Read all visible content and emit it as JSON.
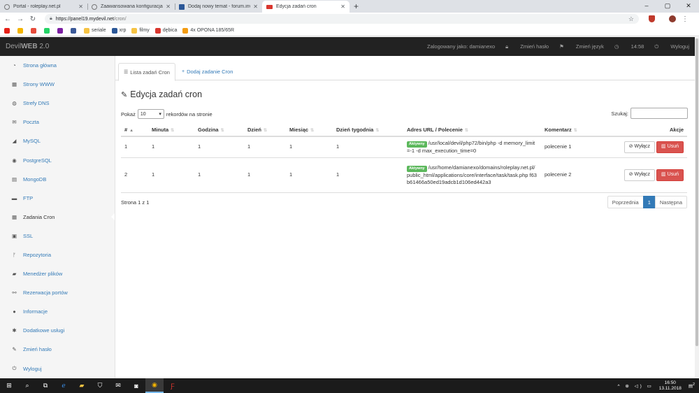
{
  "browser": {
    "tabs": [
      {
        "title": "Portal - roleplay.net.pl",
        "active": false
      },
      {
        "title": "Zaawansowana konfiguracja",
        "active": false
      },
      {
        "title": "Dodaj nowy temat - forum.invisi",
        "active": false
      },
      {
        "title": "Edycja zadań cron",
        "active": true
      }
    ],
    "new_tab": "+",
    "window_controls": [
      "–",
      "▢",
      "✕"
    ],
    "url_host": "https://panel19.mydevil.net",
    "url_path": "/cron/",
    "bookmarks": [
      {
        "label": "",
        "color": "#e62117"
      },
      {
        "label": "",
        "color": "#f4b400"
      },
      {
        "label": "",
        "color": "#e74c3c"
      },
      {
        "label": "",
        "color": "#25d366"
      },
      {
        "label": "",
        "color": "#7b1fa2"
      },
      {
        "label": "",
        "color": "#3b5998"
      },
      {
        "label": "seriale",
        "color": "#f6c343"
      },
      {
        "label": "xrp",
        "color": "#2b5797"
      },
      {
        "label": "filmy",
        "color": "#f6c343"
      },
      {
        "label": "dębica",
        "color": "#d9362e"
      },
      {
        "label": "4x OPONA 185/65R",
        "color": "#f39c12"
      }
    ]
  },
  "header": {
    "brand_main": "Devil",
    "brand_bold": "WEB",
    "brand_version": " 2.0",
    "logged_in": "Zalogowany jako: damianexo",
    "change_password": "Zmień hasło",
    "change_language": "Zmień język",
    "time": "14:58",
    "logout": "Wyloguj"
  },
  "sidebar": {
    "items": [
      {
        "label": "Strona główna",
        "icon": "dashboard-icon",
        "glyph": "◔"
      },
      {
        "label": "Strony WWW",
        "icon": "grid-icon",
        "glyph": "▦"
      },
      {
        "label": "Strefy DNS",
        "icon": "globe-icon",
        "glyph": "◍"
      },
      {
        "label": "Poczta",
        "icon": "envelope-icon",
        "glyph": "✉"
      },
      {
        "label": "MySQL",
        "icon": "dolphin-icon",
        "glyph": "◢"
      },
      {
        "label": "PostgreSQL",
        "icon": "elephant-icon",
        "glyph": "◉"
      },
      {
        "label": "MongoDB",
        "icon": "database-icon",
        "glyph": "▤"
      },
      {
        "label": "FTP",
        "icon": "folder-icon",
        "glyph": "▬"
      },
      {
        "label": "Zadania Cron",
        "icon": "calendar-icon",
        "glyph": "▦"
      },
      {
        "label": "SSL",
        "icon": "lock-icon",
        "glyph": "▣"
      },
      {
        "label": "Repozytoria",
        "icon": "branch-icon",
        "glyph": "ᚠ"
      },
      {
        "label": "Menedżer plików",
        "icon": "folder-open-icon",
        "glyph": "▰"
      },
      {
        "label": "Rezerwacja portów",
        "icon": "plug-icon",
        "glyph": "⚯"
      },
      {
        "label": "Informacje",
        "icon": "user-icon",
        "glyph": "●"
      },
      {
        "label": "Dodatkowe usługi",
        "icon": "asterisk-icon",
        "glyph": "✱"
      },
      {
        "label": "Zmień hasło",
        "icon": "pencil-icon",
        "glyph": "✎"
      },
      {
        "label": "Wyloguj",
        "icon": "power-icon",
        "glyph": "⏻"
      }
    ],
    "active_index": 8
  },
  "main": {
    "tabs": [
      {
        "label": "Lista zadań Cron",
        "glyph": "☰",
        "active": true
      },
      {
        "label": "Dodaj zadanie Cron",
        "glyph": "+",
        "active": false
      }
    ],
    "title": "Edycja zadań cron",
    "show_label": "Pokaż",
    "page_size": "10",
    "records_label": "rekordów na stronie",
    "search_label": "Szukaj:",
    "search_value": "",
    "columns": [
      "#",
      "Minuta",
      "Godzina",
      "Dzień",
      "Miesiąc",
      "Dzień tygodnia",
      "Adres URL / Polecenie",
      "Komentarz",
      "Akcje"
    ],
    "rows": [
      {
        "id": "1",
        "minute": "1",
        "hour": "1",
        "day": "1",
        "month": "1",
        "weekday": "1",
        "status": "Aktywny",
        "command": "/usr/local/devil/php72/bin/php -d memory_limit=-1 -d max_execution_time=0",
        "comment": "polecenie 1"
      },
      {
        "id": "2",
        "minute": "1",
        "hour": "1",
        "day": "1",
        "month": "1",
        "weekday": "1",
        "status": "Aktywny",
        "command": "/usr/home/damianexo/domains/roleplay.net.pl/public_html/applications/core/interface/task/task.php f63b61466a50ed19adcb1d106ed442a3",
        "comment": "polecenie 2"
      }
    ],
    "disable_label": "Wyłącz",
    "delete_label": "Usuń",
    "info": "Strona 1 z 1",
    "pager": {
      "prev": "Poprzednia",
      "current": "1",
      "next": "Następna"
    }
  },
  "taskbar": {
    "tray": "^ ⊕ ◁) ▭",
    "time": "16:50",
    "date": "13.11.2018",
    "notifications": "2"
  },
  "colors": {
    "primary": "#337ab7",
    "success": "#5cb85c",
    "danger": "#d9534f",
    "header_bg": "#222222"
  }
}
